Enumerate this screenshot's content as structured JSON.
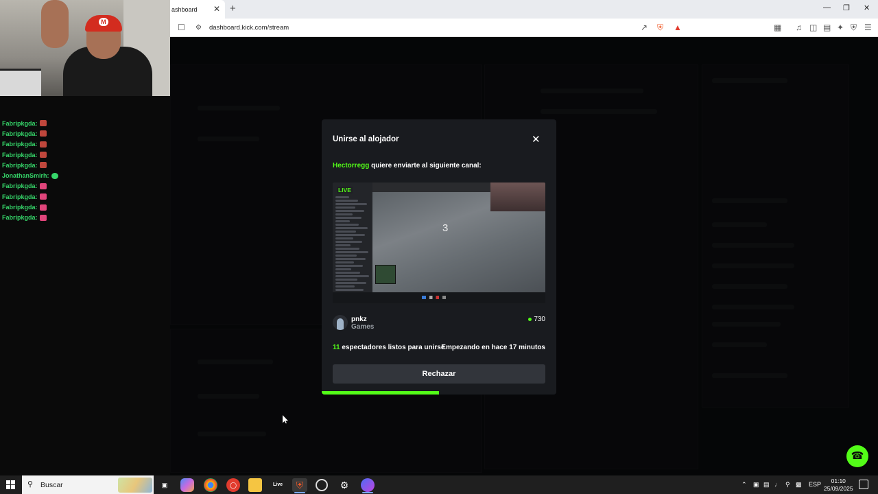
{
  "browser": {
    "tab_title": "ashboard",
    "tab_close": "✕",
    "new_tab": "+",
    "url": "dashboard.kick.com/stream"
  },
  "chat_overlay": {
    "messages": [
      {
        "user": "Fabripkgda:",
        "emote": "pepe-emote",
        "emote_color": "#c0473c"
      },
      {
        "user": "Fabripkgda:",
        "emote": "pepe-emote",
        "emote_color": "#c0473c"
      },
      {
        "user": "Fabripkgda:",
        "emote": "pepe-emote",
        "emote_color": "#c0473c"
      },
      {
        "user": "Fabripkgda:",
        "emote": "pepe-emote",
        "emote_color": "#c0473c"
      },
      {
        "user": "Fabripkgda:",
        "emote": "pepe-emote",
        "emote_color": "#c0473c"
      },
      {
        "user": "JonathanSmirh:",
        "emote": "green-emote",
        "emote_color": "#36d66a"
      },
      {
        "user": "Fabripkgda:",
        "emote": "heart-emote",
        "emote_color": "#e0457b"
      },
      {
        "user": "Fabripkgda:",
        "emote": "heart-emote",
        "emote_color": "#e0457b"
      },
      {
        "user": "Fabripkgda:",
        "emote": "heart-emote",
        "emote_color": "#e0457b"
      },
      {
        "user": "Fabripkgda:",
        "emote": "heart-emote",
        "emote_color": "#e0457b"
      }
    ]
  },
  "modal": {
    "title": "Unirse al alojador",
    "close_icon": "✕",
    "host_name": "Hectorregg",
    "invite_text": " quiere enviarte al siguiente canal:",
    "preview": {
      "live_label": "LIVE",
      "game_number": "3"
    },
    "channel": {
      "name": "pnkz",
      "category": "Games",
      "viewers": "730"
    },
    "ready_count": "11",
    "ready_text": " espectadores listos para unirse",
    "started_text": "Empezando en hace 17 minutos",
    "reject_label": "Rechazar",
    "countdown_progress": 0.5
  },
  "help_button_icon": "headset-icon",
  "taskbar": {
    "search_placeholder": "Buscar",
    "apps": [
      "task-view",
      "copilot",
      "chrome",
      "app-red",
      "file-explorer",
      "live",
      "brave",
      "obs",
      "settings",
      "messenger"
    ],
    "live_label": "Live",
    "language": "ESP",
    "time": "01:10",
    "date": "25/09/2025"
  },
  "colors": {
    "kick_green": "#53fc18",
    "modal_bg": "#191b1f",
    "button_bg": "#32353b"
  }
}
